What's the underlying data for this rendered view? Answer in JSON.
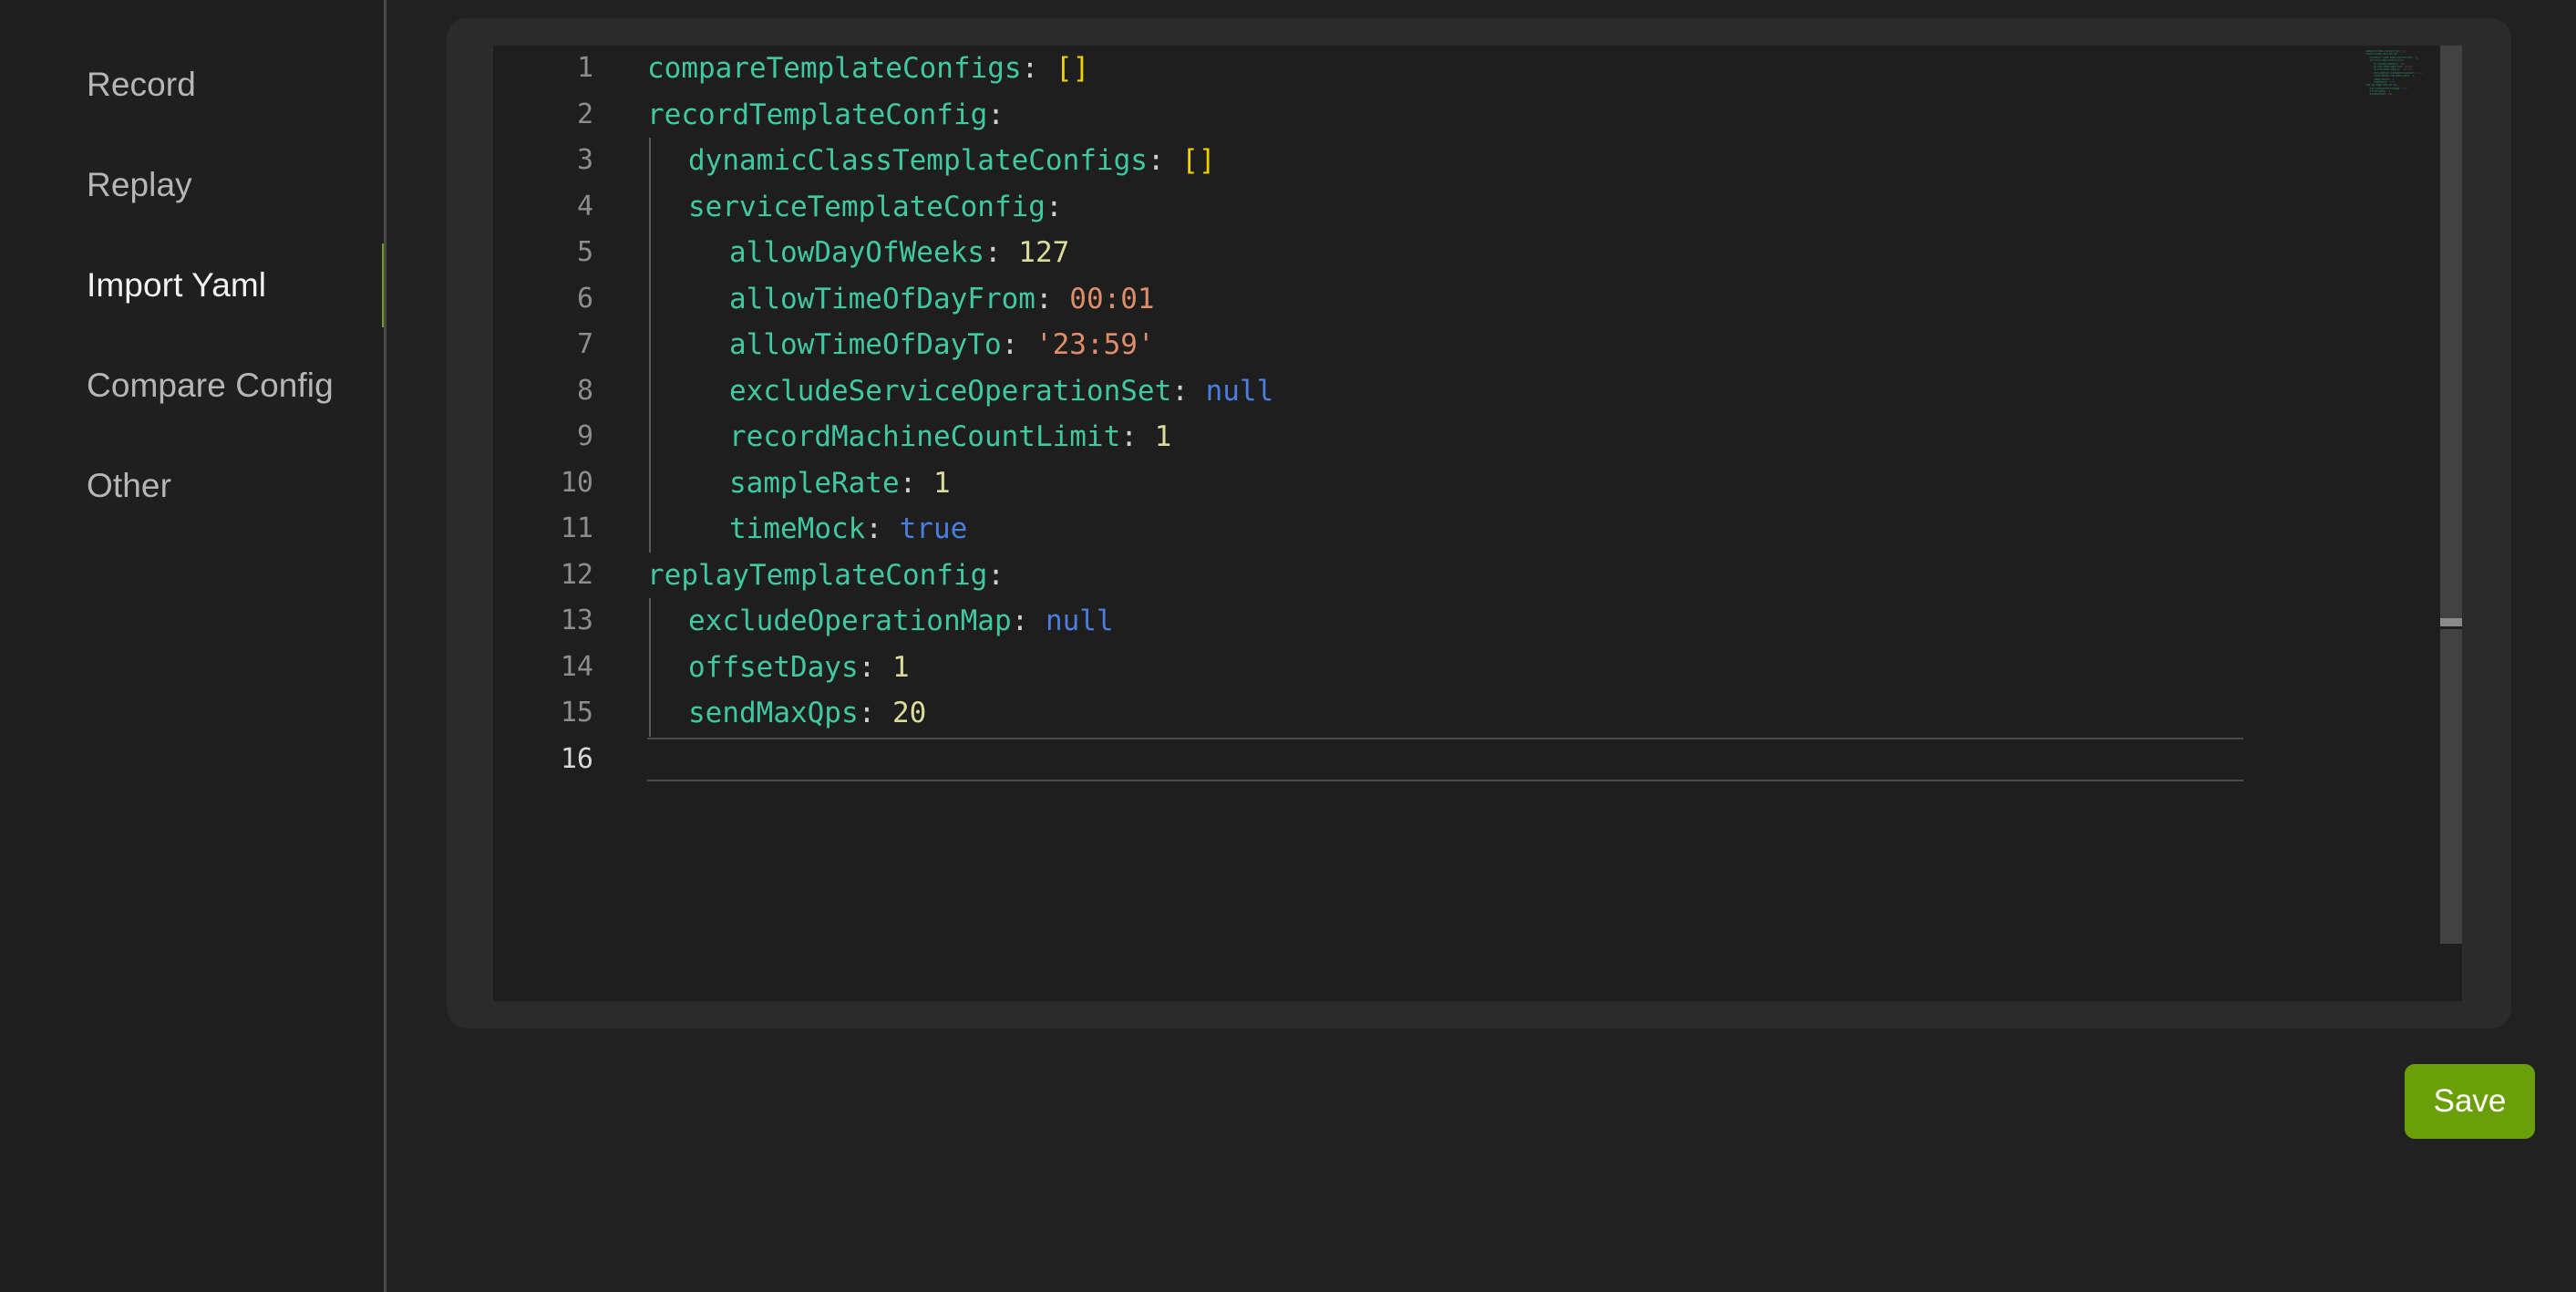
{
  "sidebar": {
    "items": [
      {
        "label": "Record",
        "active": false
      },
      {
        "label": "Replay",
        "active": false
      },
      {
        "label": "Import Yaml",
        "active": true
      },
      {
        "label": "Compare Config",
        "active": false
      },
      {
        "label": "Other",
        "active": false
      }
    ],
    "active_indicator_color": "#6aa012"
  },
  "editor": {
    "language": "yaml",
    "active_line": 16,
    "total_lines": 16,
    "line_numbers": [
      "1",
      "2",
      "3",
      "4",
      "5",
      "6",
      "7",
      "8",
      "9",
      "10",
      "11",
      "12",
      "13",
      "14",
      "15",
      "16"
    ],
    "lines": [
      {
        "n": "1",
        "indent": 0,
        "tokens": [
          {
            "t": "key",
            "v": "compareTemplateConfigs"
          },
          {
            "t": "punc",
            "v": ": "
          },
          {
            "t": "brk",
            "v": "[]"
          }
        ]
      },
      {
        "n": "2",
        "indent": 0,
        "tokens": [
          {
            "t": "key",
            "v": "recordTemplateConfig"
          },
          {
            "t": "punc",
            "v": ":"
          }
        ]
      },
      {
        "n": "3",
        "indent": 1,
        "tokens": [
          {
            "t": "key",
            "v": "dynamicClassTemplateConfigs"
          },
          {
            "t": "punc",
            "v": ": "
          },
          {
            "t": "brk",
            "v": "[]"
          }
        ]
      },
      {
        "n": "4",
        "indent": 1,
        "tokens": [
          {
            "t": "key",
            "v": "serviceTemplateConfig"
          },
          {
            "t": "punc",
            "v": ":"
          }
        ]
      },
      {
        "n": "5",
        "indent": 2,
        "tokens": [
          {
            "t": "key",
            "v": "allowDayOfWeeks"
          },
          {
            "t": "punc",
            "v": ": "
          },
          {
            "t": "num",
            "v": "127"
          }
        ]
      },
      {
        "n": "6",
        "indent": 2,
        "tokens": [
          {
            "t": "key",
            "v": "allowTimeOfDayFrom"
          },
          {
            "t": "punc",
            "v": ": "
          },
          {
            "t": "str",
            "v": "00:01"
          }
        ]
      },
      {
        "n": "7",
        "indent": 2,
        "tokens": [
          {
            "t": "key",
            "v": "allowTimeOfDayTo"
          },
          {
            "t": "punc",
            "v": ": "
          },
          {
            "t": "str",
            "v": "'23:59'"
          }
        ]
      },
      {
        "n": "8",
        "indent": 2,
        "tokens": [
          {
            "t": "key",
            "v": "excludeServiceOperationSet"
          },
          {
            "t": "punc",
            "v": ": "
          },
          {
            "t": "bool",
            "v": "null"
          }
        ]
      },
      {
        "n": "9",
        "indent": 2,
        "tokens": [
          {
            "t": "key",
            "v": "recordMachineCountLimit"
          },
          {
            "t": "punc",
            "v": ": "
          },
          {
            "t": "num",
            "v": "1"
          }
        ]
      },
      {
        "n": "10",
        "indent": 2,
        "tokens": [
          {
            "t": "key",
            "v": "sampleRate"
          },
          {
            "t": "punc",
            "v": ": "
          },
          {
            "t": "num",
            "v": "1"
          }
        ]
      },
      {
        "n": "11",
        "indent": 2,
        "tokens": [
          {
            "t": "key",
            "v": "timeMock"
          },
          {
            "t": "punc",
            "v": ": "
          },
          {
            "t": "bool",
            "v": "true"
          }
        ]
      },
      {
        "n": "12",
        "indent": 0,
        "tokens": [
          {
            "t": "key",
            "v": "replayTemplateConfig"
          },
          {
            "t": "punc",
            "v": ":"
          }
        ]
      },
      {
        "n": "13",
        "indent": 1,
        "tokens": [
          {
            "t": "key",
            "v": "excludeOperationMap"
          },
          {
            "t": "punc",
            "v": ": "
          },
          {
            "t": "bool",
            "v": "null"
          }
        ]
      },
      {
        "n": "14",
        "indent": 1,
        "tokens": [
          {
            "t": "key",
            "v": "offsetDays"
          },
          {
            "t": "punc",
            "v": ": "
          },
          {
            "t": "num",
            "v": "1"
          }
        ]
      },
      {
        "n": "15",
        "indent": 1,
        "tokens": [
          {
            "t": "key",
            "v": "sendMaxQps"
          },
          {
            "t": "punc",
            "v": ": "
          },
          {
            "t": "num",
            "v": "20"
          }
        ]
      },
      {
        "n": "16",
        "indent": 0,
        "tokens": []
      }
    ],
    "colors": {
      "background": "#1e1e1e",
      "key": "#40c9a0",
      "punctuation": "#cfcfcf",
      "bracket": "#f0d000",
      "number": "#dcdc9a",
      "string": "#e08d6a",
      "boolean": "#4a7fe0",
      "line_number": "#8d8d8d",
      "line_number_active": "#d8d8d8"
    }
  },
  "footer": {
    "save_label": "Save",
    "save_color": "#6a9f0a"
  }
}
